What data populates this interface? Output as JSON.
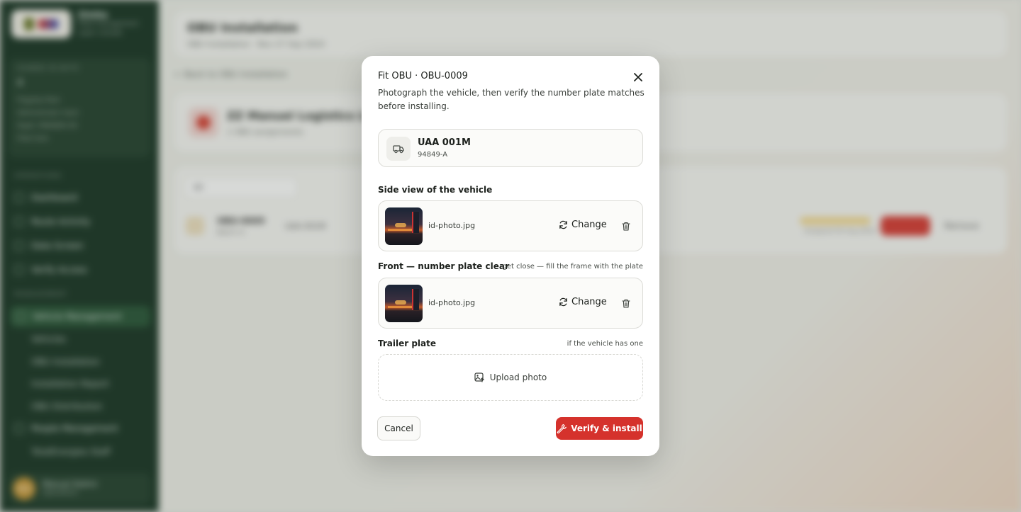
{
  "background": {
    "brand": {
      "name": "Simba",
      "subtitle": "Fleet management",
      "subtitle2": "super console"
    },
    "side_card": {
      "caption": "SIGNED IN WITH",
      "value": "4",
      "lines": [
        "Flagship fleet",
        "Administrator team",
        "Kigali, RWANDA KK",
        "Fleet lane"
      ]
    },
    "sections": [
      "OPERATIONS",
      "MANAGEMENT"
    ],
    "nav": [
      "Dashboard",
      "Route Activity",
      "Data Screen",
      "Verify Access",
      "Vehicle Management",
      "People Management"
    ],
    "subnav": [
      "Vehicles",
      "OBU Installation",
      "Installation Report",
      "OBU Distribution",
      "TotalEnergies Staff"
    ],
    "user": {
      "initials": "MO",
      "name": "Manuel Kalimi",
      "role": "Operations"
    },
    "header": {
      "title": "OBU Installation",
      "subtitle": "OBU Installation · Nov 27 Sep 2024"
    },
    "back_link": "← Back to OBU Installation",
    "client": {
      "name": "ZZ Manuel Logistics Ltd",
      "sub": "1 OBU assignments"
    },
    "filter": {
      "value": "All"
    },
    "row": {
      "id": "OBU-0009",
      "sub": "Batch A",
      "plate": "UAA 001M",
      "note": "Assigned 04 Aug 2024",
      "remove": "Remove"
    }
  },
  "modal": {
    "title": "Fit OBU · OBU-0009",
    "description": "Photograph the vehicle, then verify the number plate matches before installing.",
    "vehicle": {
      "plate": "UAA 001M",
      "code": "94849-A"
    },
    "side_view": {
      "label": "Side view of the vehicle",
      "filename": "id-photo.jpg",
      "change_label": "Change"
    },
    "front_view": {
      "label": "Front — number plate clear",
      "hint": "get close — fill the frame with the plate",
      "filename": "id-photo.jpg",
      "change_label": "Change"
    },
    "trailer": {
      "label": "Trailer plate",
      "hint": "if the vehicle has one",
      "upload_label": "Upload photo"
    },
    "cancel_label": "Cancel",
    "submit_label": "Verify & install"
  },
  "colors": {
    "primary": "#d5322c",
    "sidebar": "#1f3a2a",
    "modal_bg": "#ffffff"
  },
  "icons": [
    "close-icon",
    "truck-icon",
    "refresh-icon",
    "trash-icon",
    "image-upload-icon",
    "wrench-icon"
  ]
}
